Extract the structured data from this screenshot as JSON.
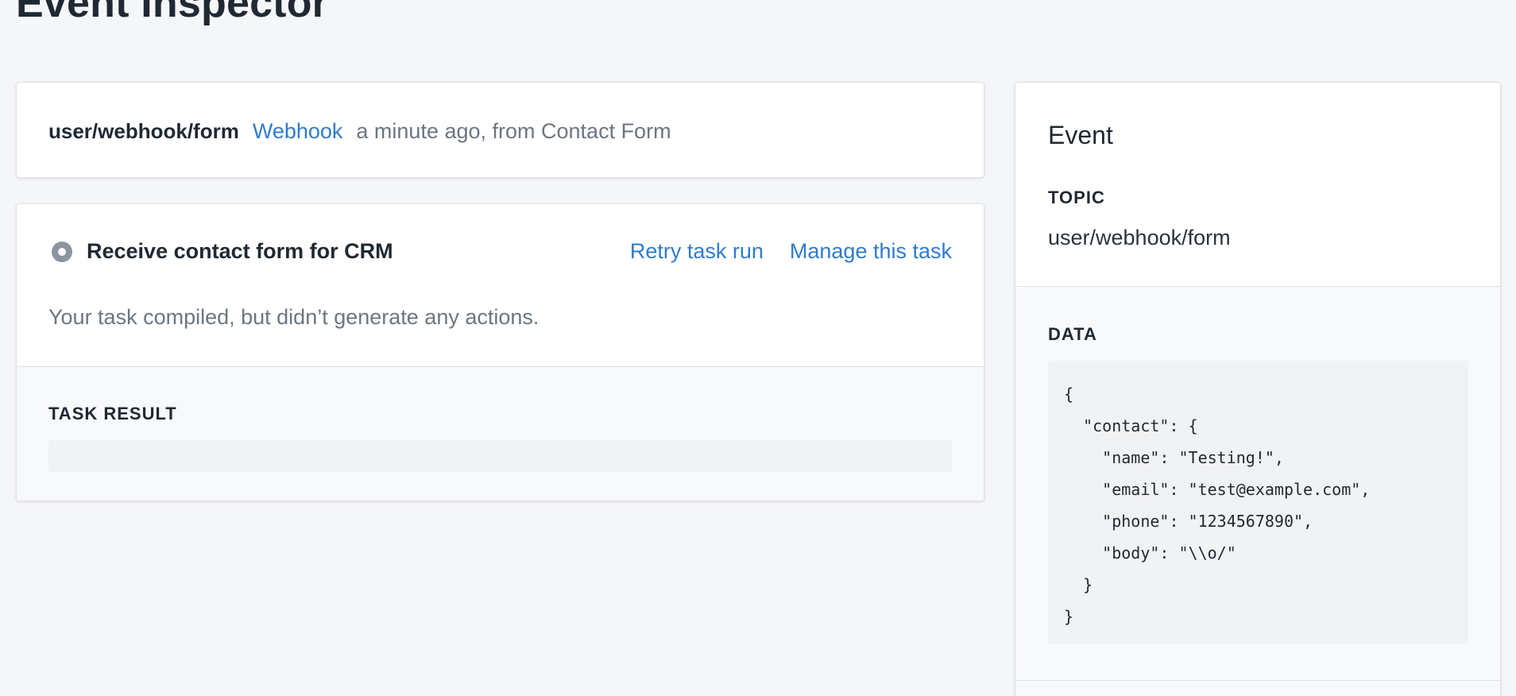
{
  "page": {
    "title": "Event Inspector"
  },
  "summary": {
    "topic": "user/webhook/form",
    "source_type": "Webhook",
    "meta": "a minute ago, from Contact Form"
  },
  "task": {
    "status_icon": "status-circle-icon",
    "name": "Receive contact form for CRM",
    "retry_label": "Retry task run",
    "manage_label": "Manage this task",
    "message": "Your task compiled, but didn’t generate any actions.",
    "result_label": "TASK RESULT",
    "result_value": ""
  },
  "event": {
    "title": "Event",
    "topic_label": "TOPIC",
    "topic_value": "user/webhook/form",
    "data_label": "DATA",
    "data_json": "{\n  \"contact\": {\n    \"name\": \"Testing!\",\n    \"email\": \"test@example.com\",\n    \"phone\": \"1234567890\",\n    \"body\": \"\\\\o/\"\n  }\n}"
  },
  "colors": {
    "background": "#f5f6f8",
    "link": "#2f7bd1",
    "muted_text": "#6b7682",
    "status_icon": "#8b95a1"
  }
}
